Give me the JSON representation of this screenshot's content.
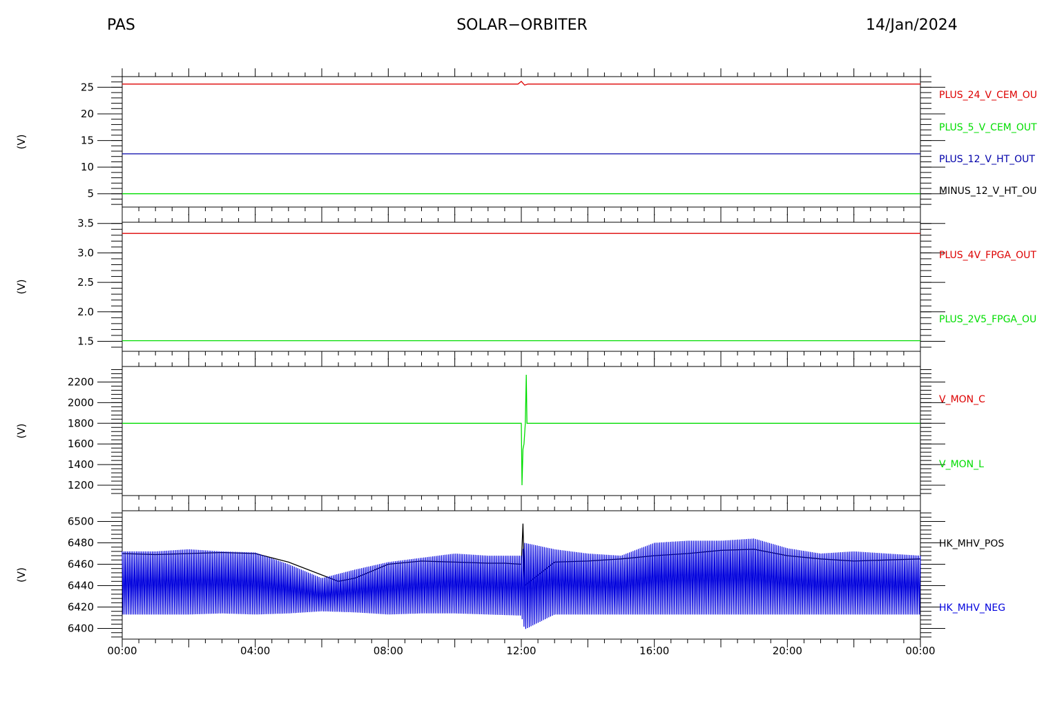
{
  "header": {
    "left": "PAS",
    "center": "SOLAR−ORBITER",
    "right": "14/Jan/2024"
  },
  "chart_data": [
    {
      "type": "line",
      "ylabel": "(V)",
      "ylim": [
        2.5,
        27
      ],
      "yticks": [
        5,
        10,
        15,
        20,
        25
      ],
      "ytick_labels": [
        "5",
        "10",
        "15",
        "20",
        "25"
      ],
      "legend": [
        "PLUS_24_V_CEM_OU",
        "PLUS_5_V_CEM_OUT",
        "PLUS_12_V_HT_OUT",
        "MINUS_12_V_HT_OU"
      ],
      "legend_colors": [
        "#dd0000",
        "#00dd00",
        "#0000aa",
        "#000000"
      ],
      "series": [
        {
          "name": "PLUS_24_V_CEM_OU",
          "color": "#dd0000",
          "x": [
            0,
            11.9,
            12.0,
            12.1,
            12.2,
            24
          ],
          "y": [
            25.6,
            25.6,
            26.1,
            25.4,
            25.6,
            25.6
          ]
        },
        {
          "name": "PLUS_5_V_CEM_OUT",
          "color": "#00dd00",
          "x": [
            0,
            24
          ],
          "y": [
            5.0,
            5.0
          ]
        },
        {
          "name": "PLUS_12_V_HT_OUT",
          "color": "#0000aa",
          "x": [
            0,
            24
          ],
          "y": [
            12.5,
            12.5
          ]
        }
      ]
    },
    {
      "type": "line",
      "ylabel": "(V)",
      "ylim": [
        1.33,
        3.52
      ],
      "yticks": [
        1.5,
        2.0,
        2.5,
        3.0,
        3.5
      ],
      "ytick_labels": [
        "1.5",
        "2.0",
        "2.5",
        "3.0",
        "3.5"
      ],
      "legend": [
        "PLUS_4V_FPGA_OUT",
        "PLUS_2V5_FPGA_OU"
      ],
      "legend_colors": [
        "#dd0000",
        "#00dd00"
      ],
      "series": [
        {
          "name": "PLUS_4V_FPGA_OUT",
          "color": "#dd0000",
          "x": [
            0,
            24
          ],
          "y": [
            3.33,
            3.33
          ]
        },
        {
          "name": "PLUS_2V5_FPGA_OU",
          "color": "#00dd00",
          "x": [
            0,
            24
          ],
          "y": [
            1.51,
            1.51
          ]
        }
      ]
    },
    {
      "type": "line",
      "ylabel": "(V)",
      "ylim": [
        1100,
        2350
      ],
      "yticks": [
        1200,
        1400,
        1600,
        1800,
        2000,
        2200
      ],
      "ytick_labels": [
        "1200",
        "1400",
        "1600",
        "1800",
        "2000",
        "2200"
      ],
      "legend": [
        "V_MON_C",
        "V_MON_L"
      ],
      "legend_colors": [
        "#dd0000",
        "#00dd00"
      ],
      "series": [
        {
          "name": "V_MON_L",
          "color": "#00dd00",
          "x": [
            0,
            12.0,
            12.02,
            12.05,
            12.08,
            12.12,
            12.15,
            12.17,
            12.2,
            24
          ],
          "y": [
            1800,
            1800,
            1200,
            1550,
            1600,
            1800,
            2270,
            1800,
            1800,
            1800
          ]
        }
      ]
    },
    {
      "type": "line",
      "ylabel": "(V)",
      "ylim": [
        6390,
        6510
      ],
      "yticks": [
        6400,
        6420,
        6440,
        6460,
        6480,
        6500
      ],
      "ytick_labels": [
        "6400",
        "6420",
        "6440",
        "6460",
        "6480",
        "6500"
      ],
      "xticks": [
        0,
        4,
        8,
        12,
        16,
        20,
        24
      ],
      "xtick_labels": [
        "00:00",
        "04:00",
        "08:00",
        "12:00",
        "16:00",
        "20:00",
        "00:00"
      ],
      "legend": [
        "HK_MHV_POS",
        "HK_MHV_NEG"
      ],
      "legend_colors": [
        "#000000",
        "#0000dd"
      ],
      "series": [
        {
          "name": "HK_MHV_POS",
          "color": "#000000",
          "x": [
            0,
            1,
            2,
            3,
            4,
            5,
            6,
            6.5,
            7,
            8,
            9,
            10,
            11,
            11.5,
            12,
            12.05,
            12.1,
            13,
            14,
            15,
            16,
            17,
            18,
            19,
            20,
            21,
            22,
            23,
            24
          ],
          "y": [
            6470,
            6469,
            6470,
            6471,
            6470,
            6462,
            6450,
            6444,
            6447,
            6460,
            6463,
            6462,
            6461,
            6461,
            6460,
            6498,
            6440,
            6462,
            6463,
            6465,
            6468,
            6470,
            6473,
            6474,
            6468,
            6465,
            6463,
            6464,
            6465
          ]
        },
        {
          "name": "HK_MHV_NEG",
          "color": "#0000dd",
          "x": [
            0,
            1,
            2,
            3,
            4,
            5,
            6,
            7,
            8,
            9,
            10,
            11,
            12,
            12.1,
            13,
            14,
            15,
            16,
            17,
            18,
            19,
            20,
            21,
            22,
            23,
            24
          ],
          "y_high": [
            6472,
            6472,
            6474,
            6472,
            6471,
            6460,
            6447,
            6455,
            6462,
            6466,
            6470,
            6468,
            6468,
            6480,
            6474,
            6470,
            6468,
            6480,
            6482,
            6482,
            6484,
            6475,
            6470,
            6472,
            6470,
            6468
          ],
          "y_low": [
            6413,
            6413,
            6413,
            6414,
            6413,
            6414,
            6416,
            6415,
            6413,
            6414,
            6414,
            6413,
            6412,
            6399,
            6413,
            6413,
            6413,
            6413,
            6413,
            6413,
            6413,
            6413,
            6413,
            6413,
            6413,
            6413
          ]
        }
      ]
    }
  ]
}
